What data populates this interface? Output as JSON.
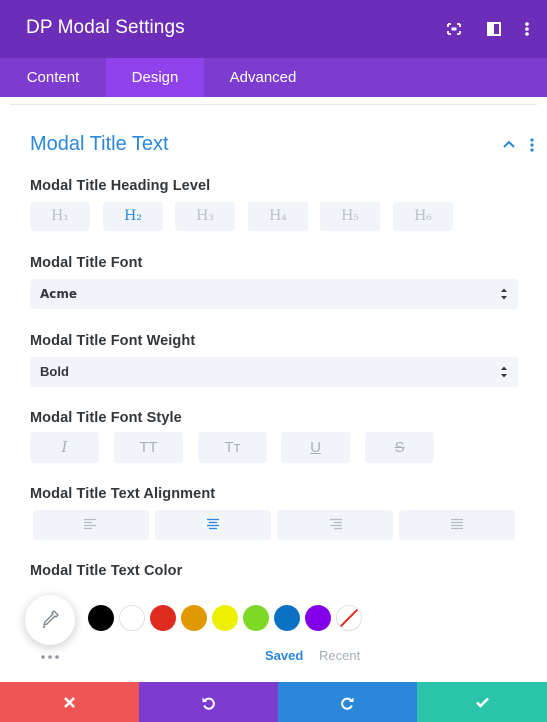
{
  "header": {
    "title": "DP Modal Settings",
    "icons": [
      "expand-icon",
      "sidebar-toggle-icon",
      "more-vertical-icon"
    ]
  },
  "tabs": [
    {
      "label": "Content",
      "active": false
    },
    {
      "label": "Design",
      "active": true
    },
    {
      "label": "Advanced",
      "active": false
    }
  ],
  "section": {
    "title": "Modal Title Text",
    "icons": [
      "chevron-up-icon",
      "more-vertical-icon"
    ]
  },
  "heading_level": {
    "label": "Modal Title Heading Level",
    "options": [
      "H₁",
      "H₂",
      "H₃",
      "H₄",
      "H₅",
      "H₆"
    ],
    "selected": "H2"
  },
  "font": {
    "label": "Modal Title Font",
    "value": "Acme"
  },
  "font_weight": {
    "label": "Modal Title Font Weight",
    "value": "Bold"
  },
  "font_style": {
    "label": "Modal Title Font Style",
    "options": [
      {
        "icon": "italic-icon",
        "glyph": "I"
      },
      {
        "icon": "uppercase-icon",
        "glyph": "TT"
      },
      {
        "icon": "capitalize-icon",
        "glyph": "Tт"
      },
      {
        "icon": "underline-icon",
        "glyph": "U"
      },
      {
        "icon": "strikethrough-icon",
        "glyph": "S"
      }
    ]
  },
  "alignment": {
    "label": "Modal Title Text Alignment",
    "options": [
      "align-left-icon",
      "align-center-icon",
      "align-right-icon",
      "align-justify-icon"
    ],
    "selected": "align-center-icon"
  },
  "text_color": {
    "label": "Modal Title Text Color",
    "swatches": [
      "#000000",
      "#ffffff",
      "#e02b20",
      "#e09900",
      "#edf000",
      "#7cda24",
      "#0c71c3",
      "#8300e9"
    ],
    "tabs": {
      "saved": "Saved",
      "recent": "Recent"
    }
  },
  "colors": {
    "header_bg": "#6c2eb9",
    "tabs_bg": "#7d3bcf",
    "tab_active_bg": "#8f42ec",
    "accent": "#2b87da",
    "footer_cancel": "#ef5555",
    "footer_undo": "#7e3bd0",
    "footer_redo": "#2b87da",
    "footer_save": "#29c4a9"
  },
  "footer": {
    "buttons": [
      "close-icon",
      "undo-icon",
      "redo-icon",
      "check-icon"
    ]
  }
}
